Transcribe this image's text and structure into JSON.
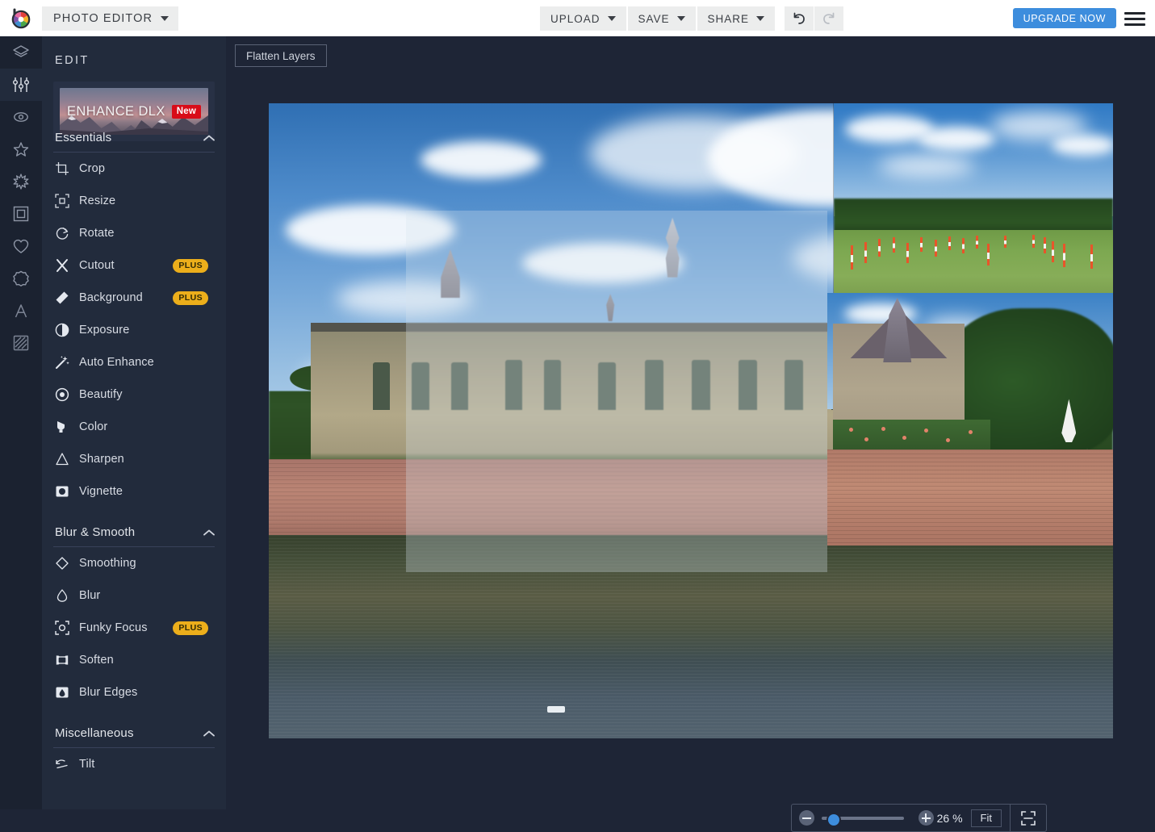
{
  "topbar": {
    "logo_icon": "aperture-logo-icon",
    "app_menu_label": "PHOTO EDITOR",
    "app_menu_caret_icon": "chevron-down-icon",
    "tools": [
      {
        "label": "UPLOAD",
        "icon": "chevron-down-icon"
      },
      {
        "label": "SAVE",
        "icon": "chevron-down-icon"
      },
      {
        "label": "SHARE",
        "icon": "chevron-down-icon"
      }
    ],
    "undo_icon": "undo-arrow-icon",
    "redo_icon": "redo-arrow-icon",
    "upgrade_label": "UPGRADE NOW",
    "upgrade_color": "#3d8ddd",
    "menu_icon": "hamburger-menu-icon"
  },
  "rail": {
    "items": [
      {
        "icon": "layers-icon",
        "active": false
      },
      {
        "icon": "adjust-sliders-icon",
        "active": true
      },
      {
        "icon": "eye-icon",
        "active": false
      },
      {
        "icon": "star-icon",
        "active": false
      },
      {
        "icon": "sparkle-burst-icon",
        "active": false
      },
      {
        "icon": "frame-icon",
        "active": false
      },
      {
        "icon": "heart-icon",
        "active": false
      },
      {
        "icon": "sticker-badge-icon",
        "active": false
      },
      {
        "icon": "text-a-icon",
        "active": false
      },
      {
        "icon": "texture-icon",
        "active": false
      }
    ]
  },
  "sidebar": {
    "title": "EDIT",
    "promo": {
      "label": "ENHANCE DLX",
      "badge": "New",
      "badge_color": "#d80c18"
    },
    "plus_badge_color": "#ecae1b",
    "groups": [
      {
        "name": "Essentials",
        "collapse_icon": "chevron-up-icon",
        "items": [
          {
            "label": "Crop",
            "icon": "crop-icon",
            "badge": ""
          },
          {
            "label": "Resize",
            "icon": "resize-icon",
            "badge": ""
          },
          {
            "label": "Rotate",
            "icon": "rotate-icon",
            "badge": ""
          },
          {
            "label": "Cutout",
            "icon": "scissors-icon",
            "badge": "PLUS"
          },
          {
            "label": "Background",
            "icon": "background-icon",
            "badge": "PLUS"
          },
          {
            "label": "Exposure",
            "icon": "exposure-icon",
            "badge": ""
          },
          {
            "label": "Auto Enhance",
            "icon": "magic-wand-icon",
            "badge": ""
          },
          {
            "label": "Beautify",
            "icon": "beautify-icon",
            "badge": ""
          },
          {
            "label": "Color",
            "icon": "color-bucket-icon",
            "badge": ""
          },
          {
            "label": "Sharpen",
            "icon": "sharpen-triangle-icon",
            "badge": ""
          },
          {
            "label": "Vignette",
            "icon": "vignette-icon",
            "badge": ""
          }
        ]
      },
      {
        "name": "Blur & Smooth",
        "collapse_icon": "chevron-up-icon",
        "items": [
          {
            "label": "Smoothing",
            "icon": "diamond-icon",
            "badge": ""
          },
          {
            "label": "Blur",
            "icon": "droplet-icon",
            "badge": ""
          },
          {
            "label": "Funky Focus",
            "icon": "funky-focus-icon",
            "badge": "PLUS"
          },
          {
            "label": "Soften",
            "icon": "soften-icon",
            "badge": ""
          },
          {
            "label": "Blur Edges",
            "icon": "blur-edges-icon",
            "badge": ""
          }
        ]
      },
      {
        "name": "Miscellaneous",
        "collapse_icon": "chevron-up-icon",
        "items": [
          {
            "label": "Tilt",
            "icon": "tilt-icon",
            "badge": ""
          }
        ]
      }
    ]
  },
  "canvas": {
    "flatten_label": "Flatten Layers",
    "background_color": "#1e2536",
    "layers": [
      {
        "name": "castle-moat-photo"
      },
      {
        "name": "green-field-photo"
      },
      {
        "name": "soft-overlay-layer"
      },
      {
        "name": "manor-wall-photo"
      }
    ]
  },
  "zoombar": {
    "minus_icon": "zoom-out-icon",
    "plus_icon": "zoom-in-icon",
    "slider_value": 6,
    "zoom_level": "26 %",
    "fit_label": "Fit",
    "fullscreen_icon": "fit-screen-icon"
  }
}
